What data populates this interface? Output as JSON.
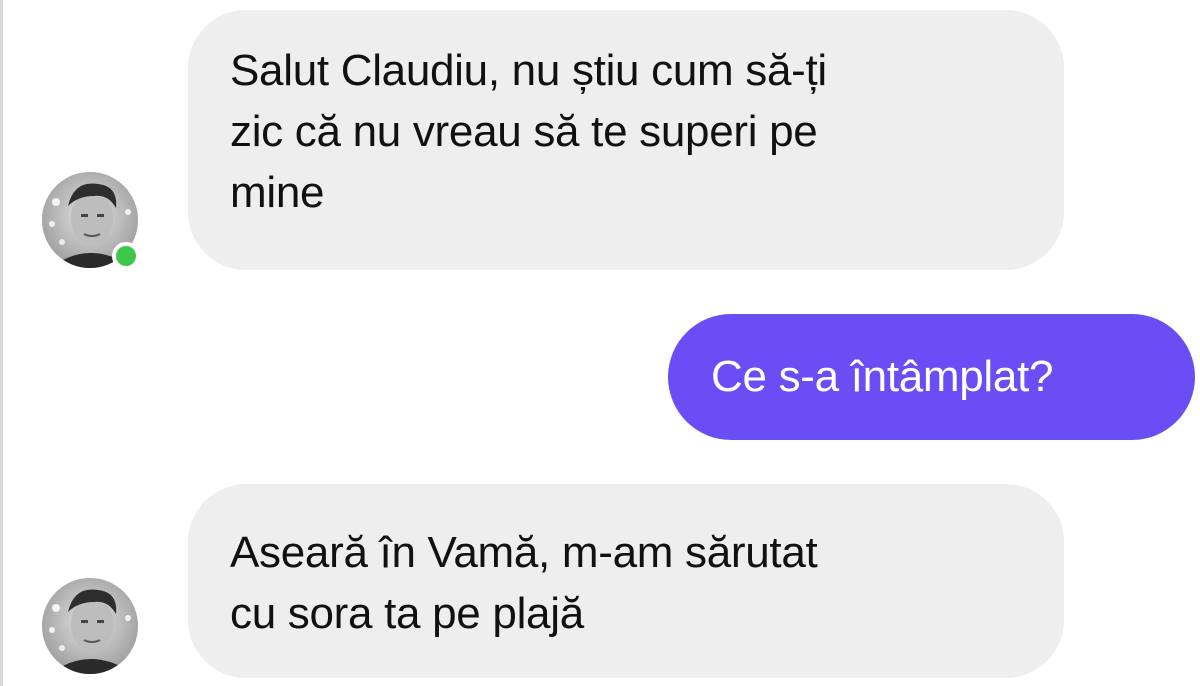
{
  "conversation": {
    "messages": [
      {
        "direction": "incoming",
        "lines": [
          "Salut Claudiu, nu știu cum să-ți",
          "zic că nu vreau să te superi pe",
          "mine"
        ]
      },
      {
        "direction": "outgoing",
        "lines": [
          "Ce s-a întâmplat?"
        ]
      },
      {
        "direction": "incoming",
        "lines": [
          "Aseară în Vamă, m-am sărutat",
          "cu sora ta pe plajă"
        ]
      }
    ],
    "contact": {
      "status": "online"
    }
  },
  "colors": {
    "incoming_bubble": "#eeeeee",
    "outgoing_bubble": "#6a4df4",
    "online_indicator": "#3ec84a"
  },
  "icons": {
    "presence": "online-status-dot-icon",
    "avatar": "contact-avatar-photo"
  }
}
